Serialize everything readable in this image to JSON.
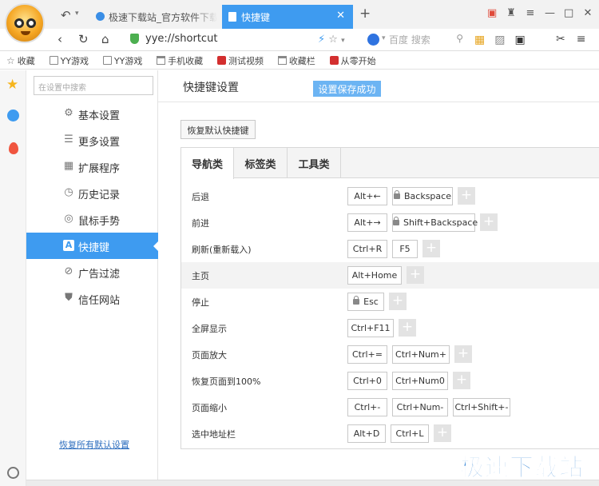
{
  "browser": {
    "tabs": [
      {
        "title": "极速下载站_官方软件下载_"
      },
      {
        "title": "快捷键"
      }
    ],
    "url": "yye://shortcut",
    "search_placeholder": "百度 搜索",
    "bookmarks": [
      "收藏",
      "YY游戏",
      "YY游戏",
      "手机收藏",
      "测试视频",
      "收藏栏",
      "从零开始"
    ]
  },
  "sidebar": {
    "search_placeholder": "在设置中搜索",
    "items": [
      {
        "label": "基本设置",
        "icon": "gear-icon"
      },
      {
        "label": "更多设置",
        "icon": "list-icon"
      },
      {
        "label": "扩展程序",
        "icon": "grid-icon"
      },
      {
        "label": "历史记录",
        "icon": "clock-icon"
      },
      {
        "label": "鼠标手势",
        "icon": "gesture-icon"
      },
      {
        "label": "快捷键",
        "icon": "shortcut-icon"
      },
      {
        "label": "广告过滤",
        "icon": "block-icon"
      },
      {
        "label": "信任网站",
        "icon": "shield-icon"
      }
    ],
    "active_index": 5,
    "restore_all": "恢复所有默认设置"
  },
  "main": {
    "title": "快捷键设置",
    "saved_badge": "设置保存成功",
    "reset_button": "恢复默认快捷键",
    "tabs": [
      "导航类",
      "标签类",
      "工具类"
    ],
    "active_tab": 0,
    "shortcuts": [
      {
        "label": "后退",
        "keys": [
          "Alt+←",
          "Backspace"
        ],
        "locked": [
          false,
          true
        ]
      },
      {
        "label": "前进",
        "keys": [
          "Alt+→",
          "Shift+Backspace"
        ],
        "locked": [
          false,
          true
        ]
      },
      {
        "label": "刷新(重新载入)",
        "keys": [
          "Ctrl+R",
          "F5"
        ],
        "locked": [
          false,
          false
        ]
      },
      {
        "label": "主页",
        "keys": [
          "Alt+Home"
        ],
        "locked": [
          false
        ]
      },
      {
        "label": "停止",
        "keys": [
          "Esc"
        ],
        "locked": [
          true
        ]
      },
      {
        "label": "全屏显示",
        "keys": [
          "Ctrl+F11"
        ],
        "locked": [
          false
        ]
      },
      {
        "label": "页面放大",
        "keys": [
          "Ctrl+=",
          "Ctrl+Num+"
        ],
        "locked": [
          false,
          false
        ]
      },
      {
        "label": "恢复页面到100%",
        "keys": [
          "Ctrl+0",
          "Ctrl+Num0"
        ],
        "locked": [
          false,
          false
        ]
      },
      {
        "label": "页面缩小",
        "keys": [
          "Ctrl+-",
          "Ctrl+Num-",
          "Ctrl+Shift+-"
        ],
        "locked": [
          false,
          false,
          false
        ]
      },
      {
        "label": "选中地址栏",
        "keys": [
          "Alt+D",
          "Ctrl+L"
        ],
        "locked": [
          false,
          false
        ]
      }
    ]
  },
  "watermark": "极速下载站",
  "colors": {
    "accent": "#3e9bf0",
    "badge": "#6cb4f3",
    "shield": "#4caf50",
    "watermark": "#2a7fd4"
  }
}
